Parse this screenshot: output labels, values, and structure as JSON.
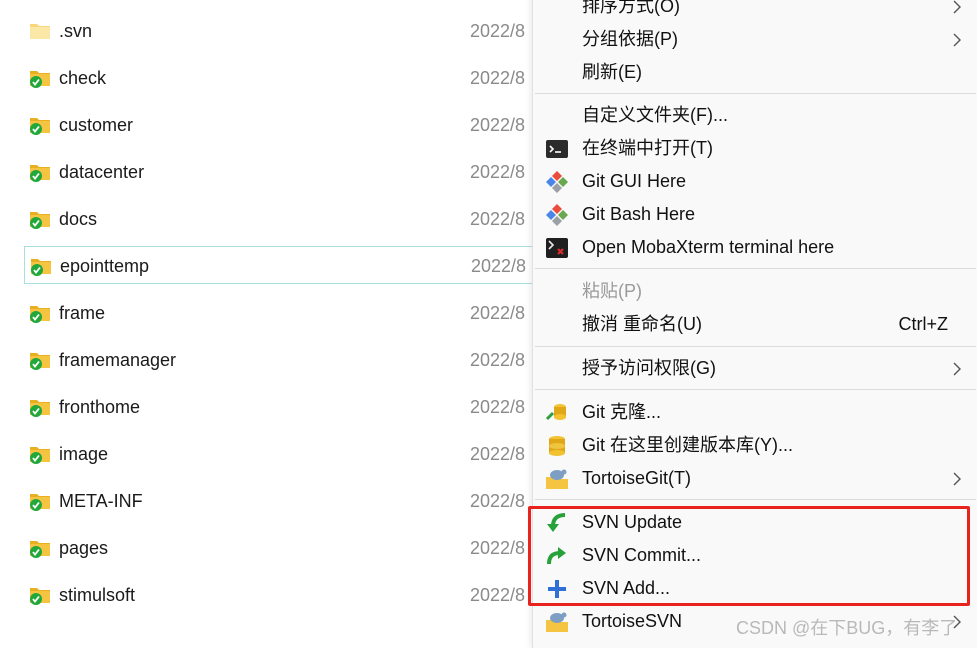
{
  "file_list": {
    "items": [
      {
        "name": ".svn",
        "date": "2022/8",
        "icon": "plain-folder-icon"
      },
      {
        "name": "check",
        "date": "2022/8",
        "icon": "svn-folder-icon"
      },
      {
        "name": "customer",
        "date": "2022/8",
        "icon": "svn-folder-icon"
      },
      {
        "name": "datacenter",
        "date": "2022/8",
        "icon": "svn-folder-icon"
      },
      {
        "name": "docs",
        "date": "2022/8",
        "icon": "svn-folder-icon"
      },
      {
        "name": "epointtemp",
        "date": "2022/8",
        "icon": "svn-folder-icon",
        "selected": true
      },
      {
        "name": "frame",
        "date": "2022/8",
        "icon": "svn-folder-icon"
      },
      {
        "name": "framemanager",
        "date": "2022/8",
        "icon": "svn-folder-icon"
      },
      {
        "name": "fronthome",
        "date": "2022/8",
        "icon": "svn-folder-icon"
      },
      {
        "name": "image",
        "date": "2022/8",
        "icon": "svn-folder-icon"
      },
      {
        "name": "META-INF",
        "date": "2022/8",
        "icon": "svn-folder-icon"
      },
      {
        "name": "pages",
        "date": "2022/8",
        "icon": "svn-folder-icon"
      },
      {
        "name": "stimulsoft",
        "date": "2022/8",
        "icon": "svn-folder-icon"
      }
    ]
  },
  "context_menu": {
    "sort_by": {
      "label": "排序方式(O)",
      "has_submenu": true
    },
    "group_by": {
      "label": "分组依据(P)",
      "has_submenu": true
    },
    "refresh": {
      "label": "刷新(E)"
    },
    "customize_folder": {
      "label": "自定义文件夹(F)..."
    },
    "open_in_terminal": {
      "label": "在终端中打开(T)",
      "icon": "terminal-icon"
    },
    "git_gui_here": {
      "label": "Git GUI Here",
      "icon": "git-gui-icon"
    },
    "git_bash_here": {
      "label": "Git Bash Here",
      "icon": "git-bash-icon"
    },
    "open_mobaxterm": {
      "label": "Open MobaXterm terminal here",
      "icon": "mobaxterm-icon"
    },
    "paste": {
      "label": "粘贴(P)",
      "disabled": true
    },
    "undo_rename": {
      "label": "撤消 重命名(U)",
      "shortcut": "Ctrl+Z"
    },
    "grant_access": {
      "label": "授予访问权限(G)",
      "has_submenu": true
    },
    "git_clone": {
      "label": "Git 克隆...",
      "icon": "git-clone-icon"
    },
    "git_create_repo": {
      "label": "Git 在这里创建版本库(Y)...",
      "icon": "git-create-repo-icon"
    },
    "tortoise_git": {
      "label": "TortoiseGit(T)",
      "icon": "tortoisegit-icon",
      "has_submenu": true
    },
    "svn_update": {
      "label": "SVN Update",
      "icon": "svn-update-icon"
    },
    "svn_commit": {
      "label": "SVN Commit...",
      "icon": "svn-commit-icon"
    },
    "svn_add": {
      "label": "SVN Add...",
      "icon": "svn-add-icon"
    },
    "tortoise_svn": {
      "label": "TortoiseSVN",
      "icon": "tortoisesvn-icon",
      "has_submenu": true
    }
  },
  "watermark": {
    "text": "CSDN @在下BUG，有李了"
  },
  "colors": {
    "highlight_border": "#e8231e",
    "selected_row_border": "#a8dfe0",
    "folder_yellow": "#f5c542",
    "svn_check_green": "#22a83a"
  }
}
